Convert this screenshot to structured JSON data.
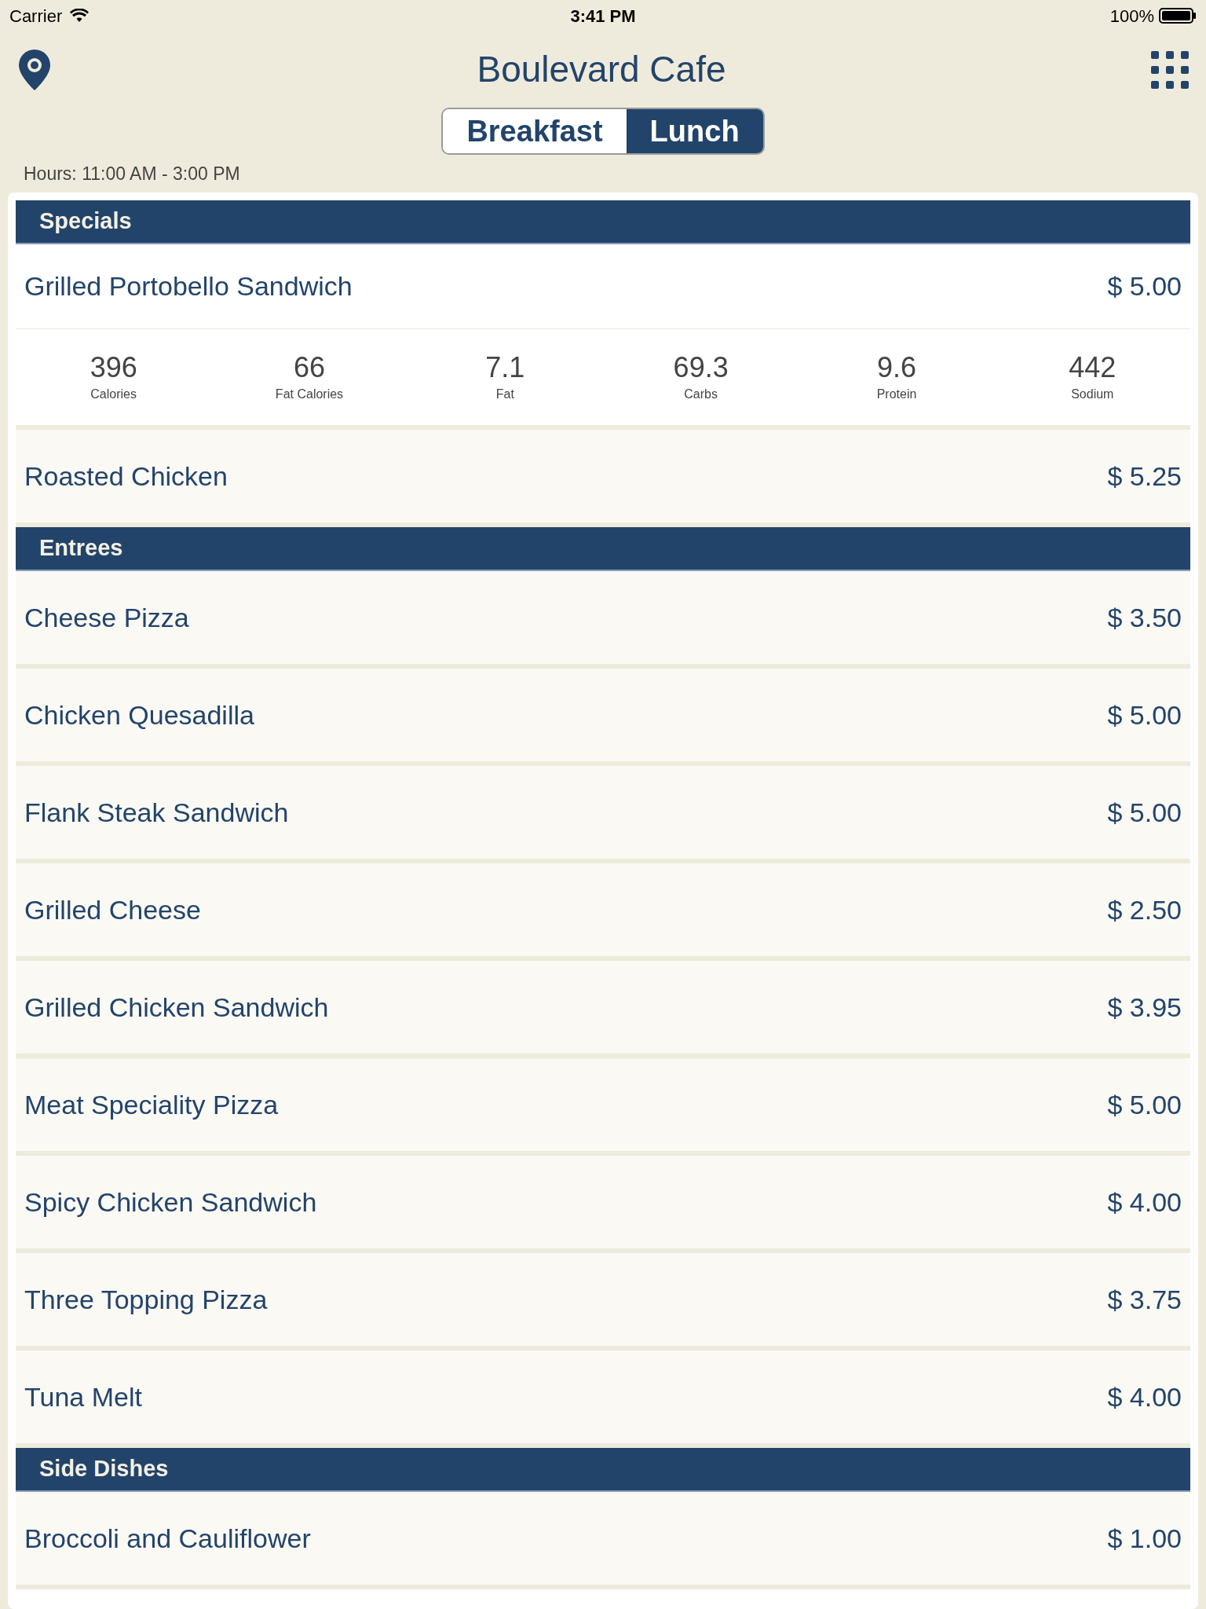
{
  "status_bar": {
    "carrier": "Carrier",
    "time": "3:41 PM",
    "battery": "100%"
  },
  "header": {
    "title": "Boulevard Cafe"
  },
  "tabs": [
    {
      "label": "Breakfast",
      "selected": false
    },
    {
      "label": "Lunch",
      "selected": true
    }
  ],
  "hours": "Hours: 11:00 AM - 3:00 PM",
  "sections": [
    {
      "title": "Specials",
      "items": [
        {
          "name": "Grilled Portobello Sandwich",
          "price": "$ 5.00",
          "expanded": true,
          "nutrition": [
            {
              "value": "396",
              "label": "Calories"
            },
            {
              "value": "66",
              "label": "Fat Calories"
            },
            {
              "value": "7.1",
              "label": "Fat"
            },
            {
              "value": "69.3",
              "label": "Carbs"
            },
            {
              "value": "9.6",
              "label": "Protein"
            },
            {
              "value": "442",
              "label": "Sodium"
            }
          ]
        },
        {
          "name": "Roasted Chicken",
          "price": "$ 5.25",
          "expanded": false
        }
      ]
    },
    {
      "title": "Entrees",
      "items": [
        {
          "name": "Cheese Pizza",
          "price": "$ 3.50",
          "expanded": false
        },
        {
          "name": "Chicken Quesadilla",
          "price": "$ 5.00",
          "expanded": false
        },
        {
          "name": "Flank Steak Sandwich",
          "price": "$ 5.00",
          "expanded": false
        },
        {
          "name": "Grilled Cheese",
          "price": "$ 2.50",
          "expanded": false
        },
        {
          "name": "Grilled Chicken Sandwich",
          "price": "$ 3.95",
          "expanded": false
        },
        {
          "name": "Meat Speciality Pizza",
          "price": "$ 5.00",
          "expanded": false
        },
        {
          "name": "Spicy Chicken Sandwich",
          "price": "$ 4.00",
          "expanded": false
        },
        {
          "name": "Three Topping Pizza",
          "price": "$ 3.75",
          "expanded": false
        },
        {
          "name": "Tuna Melt",
          "price": "$ 4.00",
          "expanded": false
        }
      ]
    },
    {
      "title": "Side Dishes",
      "items": [
        {
          "name": "Broccoli and Cauliflower",
          "price": "$ 1.00",
          "expanded": false
        }
      ]
    }
  ]
}
